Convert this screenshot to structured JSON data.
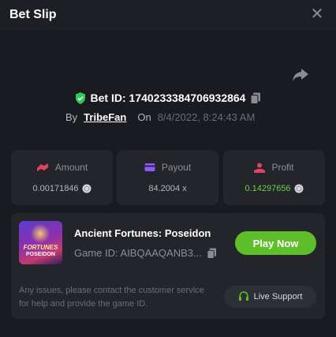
{
  "header": {
    "title": "Bet Slip"
  },
  "bet": {
    "id_label": "Bet ID: 1740233384706932864",
    "by_label": "By",
    "user": "TribeFan",
    "on_label": "On",
    "date": "8/4/2022, 8:24:43 AM"
  },
  "stats": {
    "amount": {
      "label": "Amount",
      "value": "0.00171846"
    },
    "payout": {
      "label": "Payout",
      "value": "84.2004 x"
    },
    "profit": {
      "label": "Profit",
      "value": "0.14297656"
    }
  },
  "game": {
    "thumb_line1": "FORTUNES",
    "thumb_line2": "POSEIDON",
    "name": "Ancient Fortunes: Poseidon",
    "id_label": "Game ID: AIBQAAQANB3...",
    "play_label": "Play Now"
  },
  "support": {
    "notice": "Any issues, please contact the customer service for help and provide the game ID.",
    "button_label": "Live Support"
  },
  "colors": {
    "accent_green": "#5fbf2a",
    "profit_green": "#6ad04a",
    "shield_green": "#2ecc5a",
    "amount_icon": "#e0445c",
    "payout_icon": "#8e5cf0",
    "profit_icon": "#e0445c"
  },
  "icons": [
    "close-icon",
    "share-icon",
    "shield-check-icon",
    "copy-icon",
    "amount-icon",
    "payout-icon",
    "profit-icon",
    "coin-icon",
    "headset-icon"
  ]
}
